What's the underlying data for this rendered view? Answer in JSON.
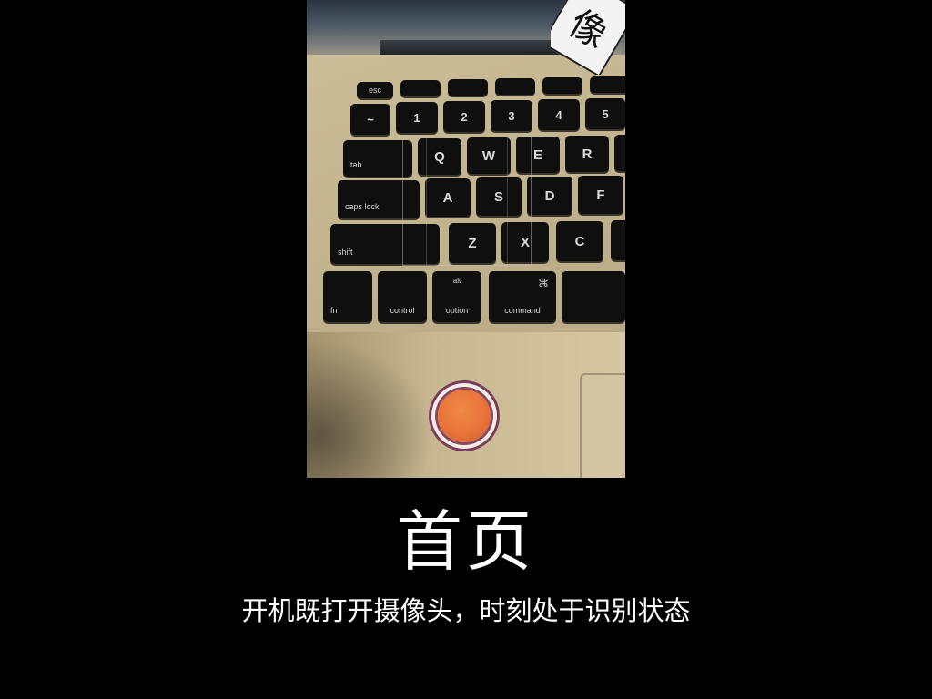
{
  "slide": {
    "title": "首页",
    "subtitle": "开机既打开摄像头，时刻处于识别状态"
  },
  "camera": {
    "sticker_glyph": "像",
    "keys": {
      "esc": "esc",
      "num1": "1",
      "num2": "2",
      "num3": "3",
      "num4": "4",
      "num5": "5",
      "q": "Q",
      "w": "W",
      "e": "E",
      "r": "R",
      "a": "A",
      "s": "S",
      "d": "D",
      "f": "F",
      "z": "Z",
      "x": "X",
      "c": "C",
      "tab": "tab",
      "caps": "caps lock",
      "shift": "shift",
      "fn": "fn",
      "control": "control",
      "option": "option",
      "alt": "alt",
      "command": "command",
      "cmd_symbol": "⌘",
      "tilde": "~"
    }
  },
  "shutter": {
    "label": ""
  }
}
